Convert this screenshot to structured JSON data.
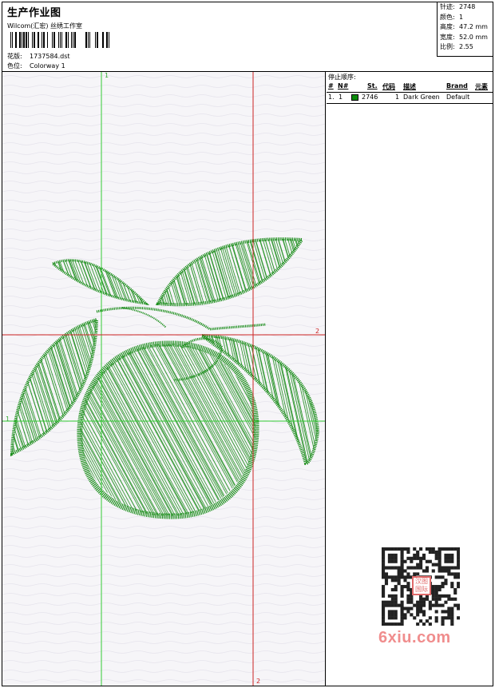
{
  "header": {
    "title": "生产作业图",
    "company": "Wilcom(汇宏) 丝绣工作室",
    "design_label": "花版:",
    "design_value": "1737584.dst",
    "colorway_label": "色位:",
    "colorway_value": "Colorway 1"
  },
  "stats": [
    {
      "label": "针迹:",
      "value": "2748"
    },
    {
      "label": "颜色:",
      "value": "1"
    },
    {
      "label": "高度:",
      "value": "47.2 mm"
    },
    {
      "label": "宽度:",
      "value": "52.0 mm"
    },
    {
      "label": "比例:",
      "value": "2.55"
    }
  ],
  "crosshairs": {
    "green_label_top": "1",
    "green_label_left": "1",
    "red_label_right": "2",
    "red_label_bottom": "2",
    "green_color": "#33cc33",
    "red_color": "#cc2222"
  },
  "stop_sequence": {
    "title": "停止顺序:",
    "columns": [
      "#",
      "N#",
      "St.",
      "代码",
      "描述",
      "Brand",
      "元素"
    ],
    "rows": [
      {
        "index": "1.",
        "needle": "1",
        "color": "#0a8a0a",
        "stitches": "2746",
        "code": "1",
        "description": "Dark Green",
        "brand": "Default",
        "element": ""
      }
    ]
  },
  "design_color": "#1f8f1f",
  "watermark": {
    "site": "6xiu.com",
    "stamp": "汉图 国际"
  }
}
